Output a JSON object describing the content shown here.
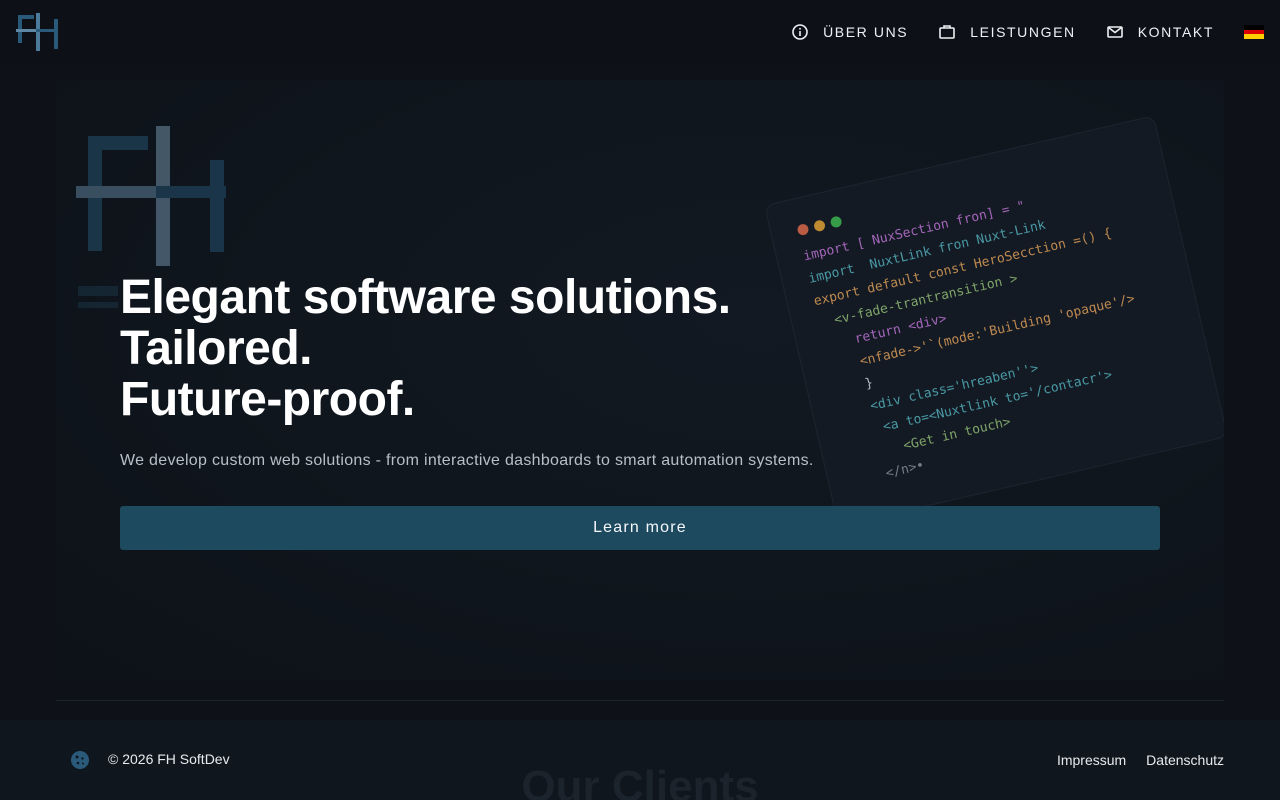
{
  "header": {
    "logo_icon": "fh-logo",
    "nav": [
      {
        "label": "ÜBER UNS",
        "icon": "info-circle-icon"
      },
      {
        "label": "LEISTUNGEN",
        "icon": "briefcase-icon"
      },
      {
        "label": "KONTAKT",
        "icon": "mail-icon"
      }
    ],
    "language_icon": "german-flag-icon"
  },
  "hero": {
    "headline": [
      "Elegant software solutions.",
      "Tailored.",
      "Future-proof."
    ],
    "subtext": "We develop custom web solutions - from interactive dashboards to smart automation systems.",
    "cta_label": "Learn more",
    "code": [
      "import [ NuxSection fron] = \"",
      "import  NuxtLink fron Nuxt-Link",
      "",
      "export default const HeroSecction =() {",
      "  <v-fade-trantransition >",
      "    return <div>",
      "    <nfade->'`(mode:'Building 'opaque'/>",
      "    }",
      "    <div class='hreaben''>",
      "     <a to=<Nuxtlink to='/contacr'>",
      "       <Get in touch>",
      "    </n>•"
    ]
  },
  "footer": {
    "cookie_icon": "cookie-icon",
    "copyright": "© 2026 FH SoftDev",
    "links": [
      "Impressum",
      "Datenschutz"
    ],
    "section_title": "Our Clients"
  },
  "colors": {
    "background": "#0e1218",
    "accent": "#1e4a60",
    "logo_blue": "#2a5a7a"
  }
}
